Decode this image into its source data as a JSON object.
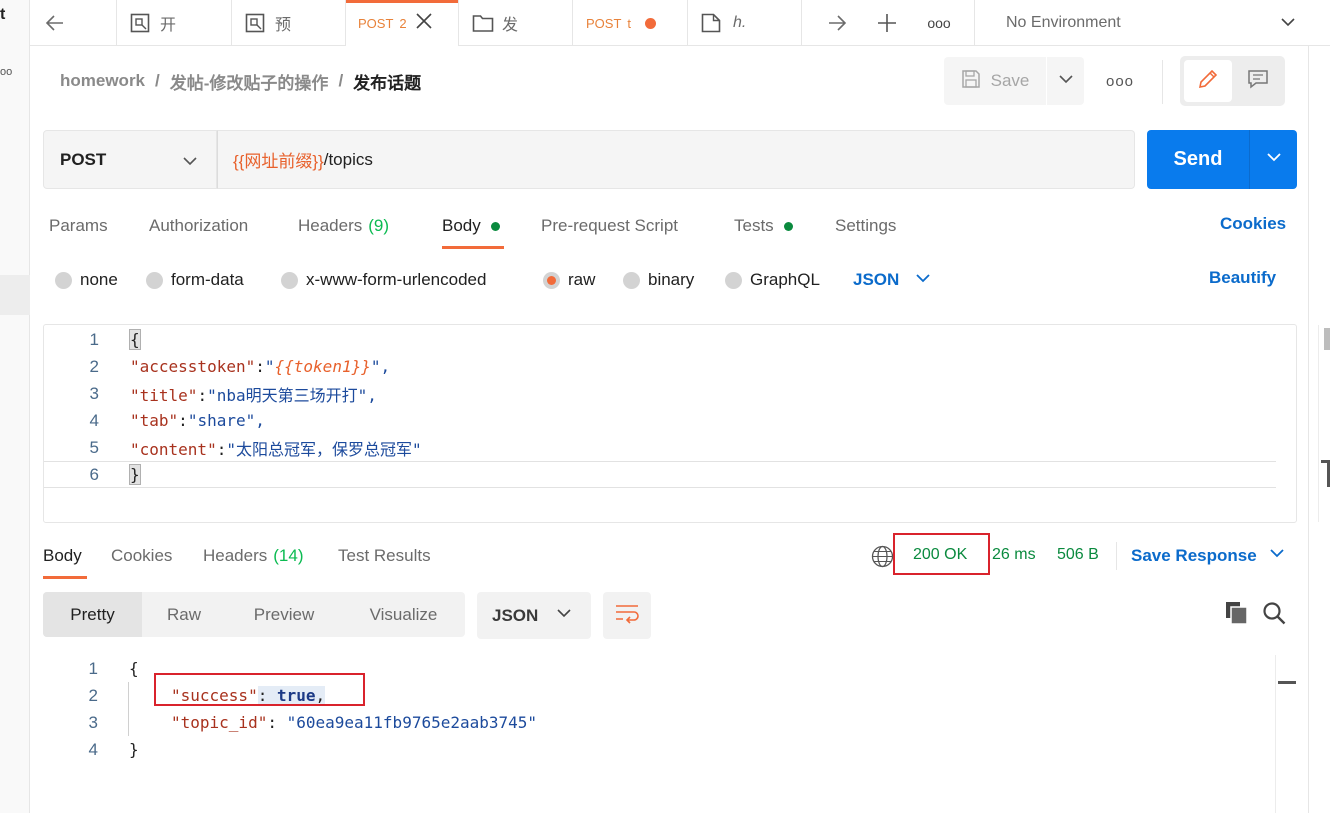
{
  "left_strip": {
    "initial": "t",
    "dots": "oo"
  },
  "tabs": [
    {
      "label": "开",
      "icon": "request-icon"
    },
    {
      "label": "预",
      "icon": "request-icon"
    },
    {
      "method": "POST",
      "label": "2",
      "icon": "close-icon",
      "active": true
    },
    {
      "label": "发",
      "icon": "folder-icon"
    },
    {
      "method": "POST",
      "label": "t",
      "icon": "unsaved-dot-icon"
    },
    {
      "label": "h.",
      "icon": "doc-icon"
    }
  ],
  "tabbar_actions": {
    "more": "ooo"
  },
  "environment": {
    "selected": "No Environment"
  },
  "breadcrumb": {
    "collection": "homework",
    "folder": "发帖-修改贴子的操作",
    "request": "发布话题",
    "sep": "/"
  },
  "toolbar": {
    "save_label": "Save",
    "more": "ooo"
  },
  "request": {
    "method": "POST",
    "url_var": "{{网址前缀}}",
    "url_path": "/topics",
    "send_label": "Send"
  },
  "request_tabs": {
    "params": "Params",
    "authorization": "Authorization",
    "headers": "Headers",
    "headers_count": "(9)",
    "body": "Body",
    "prerequest": "Pre-request Script",
    "tests": "Tests",
    "settings": "Settings",
    "cookies": "Cookies"
  },
  "body_modes": {
    "none": "none",
    "form_data": "form-data",
    "urlencoded": "x-www-form-urlencoded",
    "raw": "raw",
    "binary": "binary",
    "graphql": "GraphQL",
    "language": "JSON",
    "beautify": "Beautify",
    "selected": "raw"
  },
  "request_body": {
    "line_numbers": [
      "1",
      "2",
      "3",
      "4",
      "5",
      "6"
    ],
    "open_brace": "{",
    "close_brace": "}",
    "k1": "\"accesstoken\"",
    "v1_pre": "\"",
    "v1_var": "{{token1}}",
    "v1_post": "\",",
    "k2": "\"title\"",
    "v2": "\"nba明天第三场开打\",",
    "k3": "\"tab\"",
    "v3": "\"share\",",
    "k4": "\"content\"",
    "v4": "\"太阳总冠军，保罗总冠军\"",
    "colon": ":"
  },
  "response_tabs": {
    "body": "Body",
    "cookies": "Cookies",
    "headers": "Headers",
    "headers_count": "(14)",
    "test_results": "Test Results"
  },
  "response_meta": {
    "status": "200 OK",
    "time": "26 ms",
    "size": "506 B",
    "save_response": "Save Response"
  },
  "response_view": {
    "pretty": "Pretty",
    "raw": "Raw",
    "preview": "Preview",
    "visualize": "Visualize",
    "format": "JSON"
  },
  "response_body": {
    "line_numbers": [
      "1",
      "2",
      "3",
      "4"
    ],
    "open_brace": "{",
    "close_brace": "}",
    "k1": "\"success\"",
    "v1": "true",
    "comma": ",",
    "k2": "\"topic_id\"",
    "v2": "\"60ea9ea11fb9765e2aab3745\"",
    "colon": ": "
  },
  "colors": {
    "accent_orange": "#f26b3a",
    "send_blue": "#097bed",
    "link_blue": "#0b6bcb",
    "status_green": "#0a8a3e",
    "highlight_red": "#d9232c"
  }
}
